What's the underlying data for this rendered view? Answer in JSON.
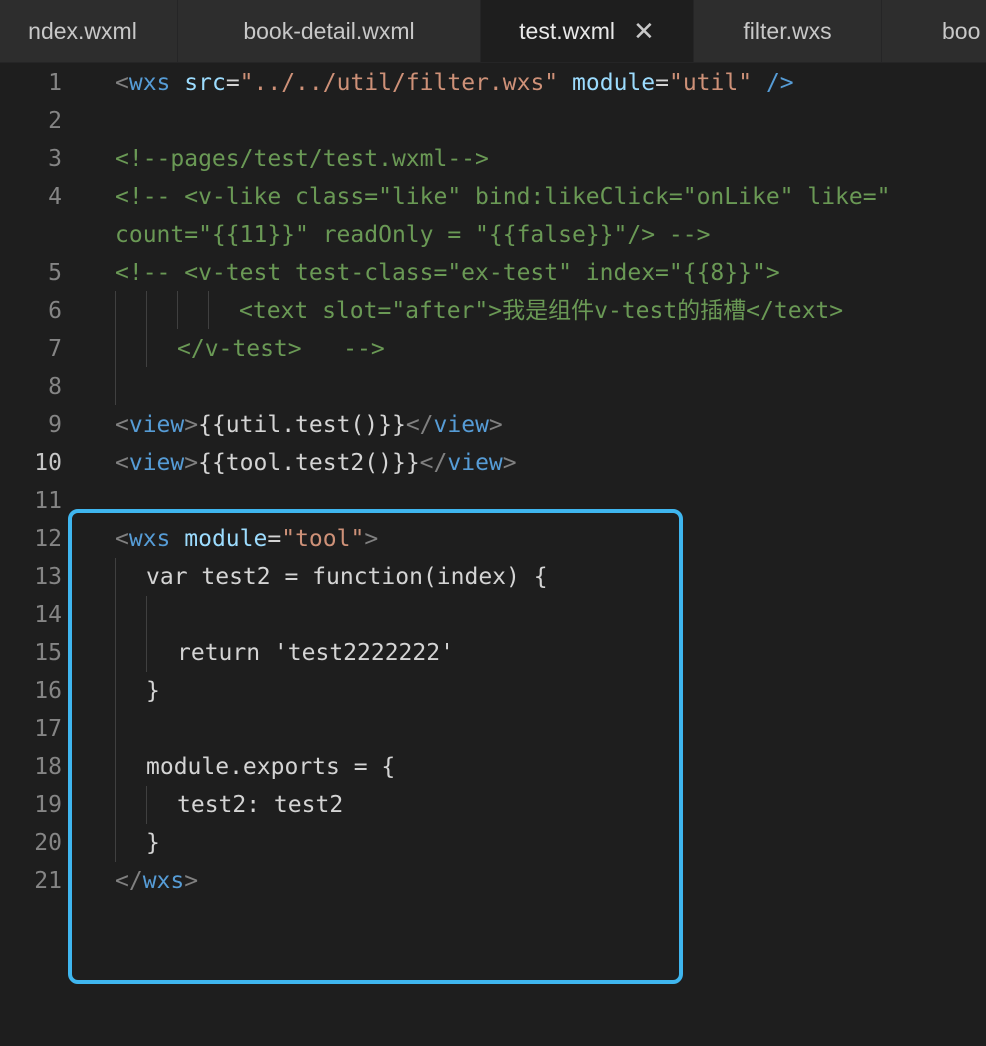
{
  "tabs": [
    {
      "label": "ndex.wxml"
    },
    {
      "label": "book-detail.wxml"
    },
    {
      "label": "test.wxml",
      "active": true
    },
    {
      "label": "filter.wxs"
    },
    {
      "label": "boo"
    }
  ],
  "close_glyph": "✕",
  "line_numbers": [
    "1",
    "2",
    "3",
    "4",
    "5",
    "6",
    "7",
    "8",
    "9",
    "10",
    "11",
    "12",
    "13",
    "14",
    "15",
    "16",
    "17",
    "18",
    "19",
    "20",
    "21"
  ],
  "current_line": "10",
  "code": {
    "l1": [
      "<",
      "wxs",
      " ",
      "src",
      "=",
      "\"../../util/filter.wxs\"",
      " ",
      "module",
      "=",
      "\"util\"",
      " ",
      "/>"
    ],
    "l3": "<!--pages/test/test.wxml-->",
    "l4a": "<!-- <v-like class=\"like\" bind:likeClick=\"onLike\" like=\"",
    "l4b": "count=\"{{11}}\" readOnly = \"{{false}}\"/> -->",
    "l5": "<!-- <v-test test-class=\"ex-test\" index=\"{{8}}\">",
    "l6": "<text slot=\"after\">我是组件v-test的插槽</text>",
    "l7": "</v-test>   -->",
    "l9": [
      "<",
      "view",
      ">",
      "{{util.test()}}",
      "</",
      "view",
      ">"
    ],
    "l10": [
      "<",
      "view",
      ">",
      "{{tool.test2()}}",
      "</",
      "view",
      ">"
    ],
    "l12": [
      "<",
      "wxs",
      " ",
      "module",
      "=",
      "\"tool\"",
      ">"
    ],
    "l13": "var test2 = function(index) {",
    "l15": "return 'test2222222'",
    "l16": "}",
    "l18": "module.exports = {",
    "l19": "test2: test2",
    "l20": "}",
    "l21": [
      "</",
      "wxs",
      ">"
    ]
  },
  "colors": {
    "background": "#1e1e1e",
    "tag": "#569cd6",
    "attribute": "#9cdcfe",
    "string": "#ce9178",
    "comment": "#6a9955",
    "highlight_border": "#3fb6ef"
  }
}
